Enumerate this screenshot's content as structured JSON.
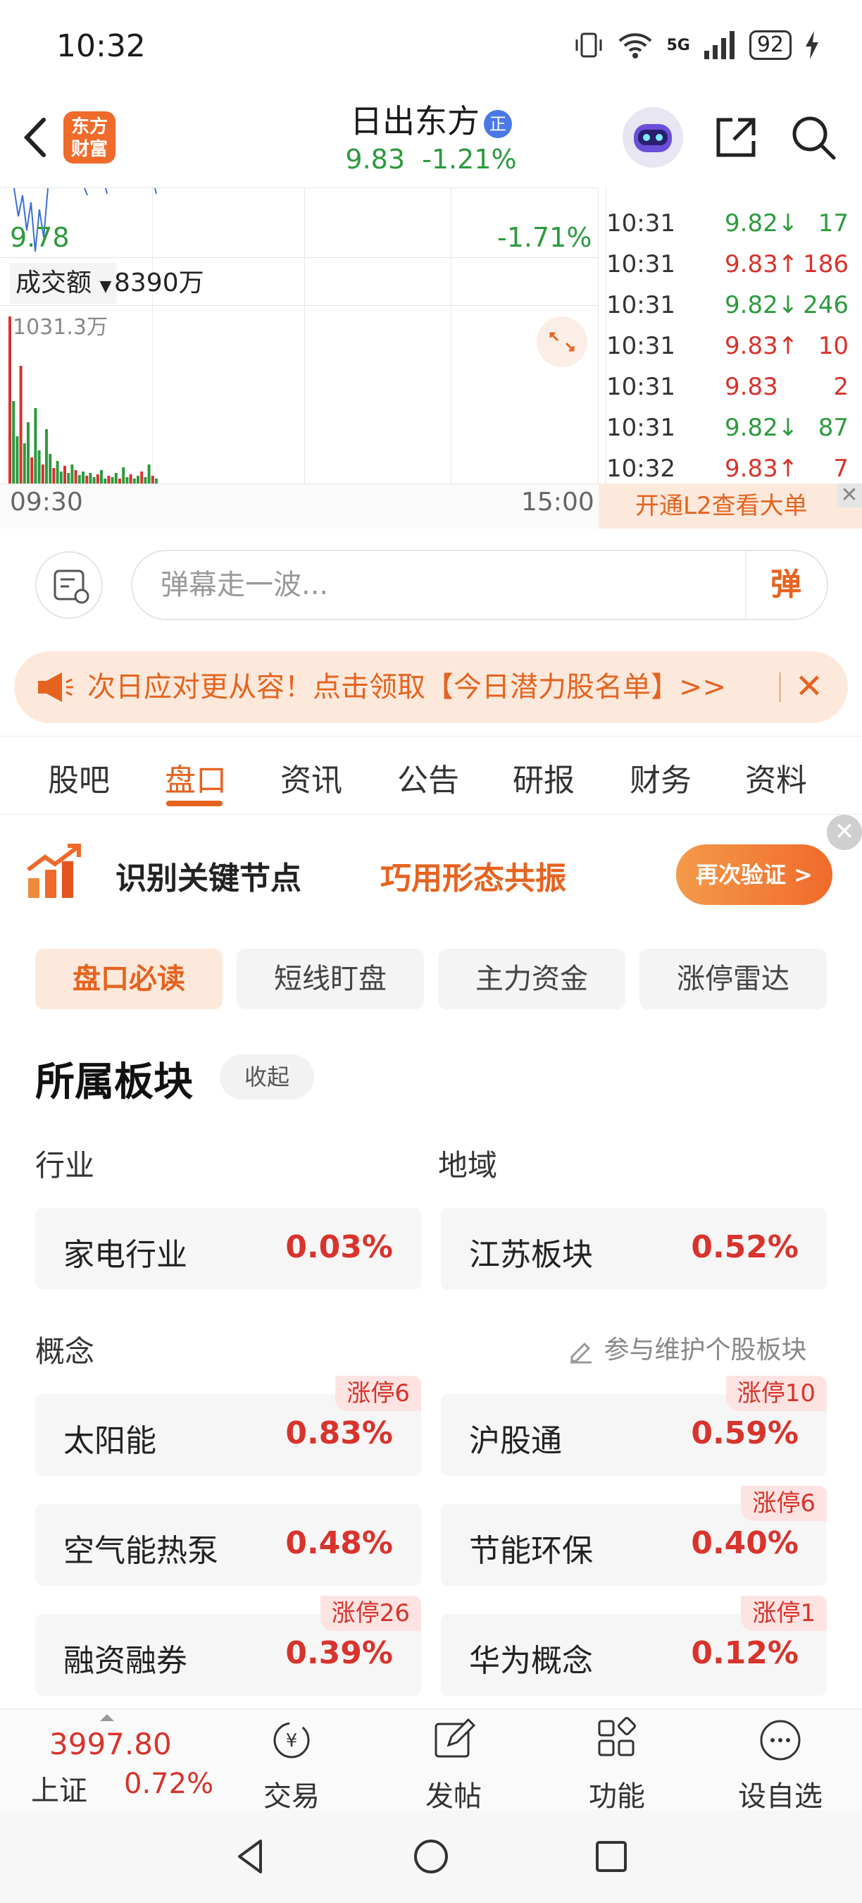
{
  "status_bar": {
    "time": "10:32",
    "network": "5G",
    "battery": "92"
  },
  "header": {
    "logo_text": "东方\n财富",
    "stock_name": "日出东方",
    "stock_tag": "正",
    "price": "9.83",
    "change_pct": "-1.21%"
  },
  "chart": {
    "low_price_label": "9.78",
    "low_pct_label": "-1.71%",
    "volume_selector": "成交额",
    "volume_total": "8390万",
    "volume_max_label": "1031.3万",
    "time_start": "09:30",
    "time_end": "15:00"
  },
  "ticks": [
    {
      "time": "10:31",
      "price": "9.82",
      "dir": "down",
      "vol": "17",
      "color": "#2d9a3e"
    },
    {
      "time": "10:31",
      "price": "9.83",
      "dir": "up",
      "vol": "186",
      "color": "#d8332c"
    },
    {
      "time": "10:31",
      "price": "9.82",
      "dir": "down",
      "vol": "246",
      "color": "#2d9a3e"
    },
    {
      "time": "10:31",
      "price": "9.83",
      "dir": "up",
      "vol": "10",
      "color": "#d8332c"
    },
    {
      "time": "10:31",
      "price": "9.83",
      "dir": "none",
      "vol": "2",
      "color": "#d8332c"
    },
    {
      "time": "10:31",
      "price": "9.82",
      "dir": "down",
      "vol": "87",
      "color": "#2d9a3e"
    },
    {
      "time": "10:32",
      "price": "9.83",
      "dir": "up",
      "vol": "7",
      "color": "#d8332c"
    }
  ],
  "l2_banner": "开通L2查看大单",
  "danmu": {
    "placeholder": "弹幕走一波...",
    "send_label": "弹"
  },
  "promo": {
    "text": "次日应对更从容！点击领取【今日潜力股名单】>>"
  },
  "tabs": [
    "股吧",
    "盘口",
    "资讯",
    "公告",
    "研报",
    "财务",
    "资料"
  ],
  "active_tab": "盘口",
  "ad": {
    "title": "识别关键节点",
    "subtitle": "巧用形态共振",
    "button": "再次验证 >"
  },
  "subtabs": [
    "盘口必读",
    "短线盯盘",
    "主力资金",
    "涨停雷达"
  ],
  "sector": {
    "title": "所属板块",
    "collapse": "收起",
    "industry_label": "行业",
    "region_label": "地域",
    "concept_label": "概念",
    "maintain_link": "参与维护个股板块",
    "industry": {
      "name": "家电行业",
      "pct": "0.03%"
    },
    "region": {
      "name": "江苏板块",
      "pct": "0.52%"
    },
    "concepts": [
      {
        "name": "太阳能",
        "pct": "0.83%",
        "badge": "涨停6"
      },
      {
        "name": "沪股通",
        "pct": "0.59%",
        "badge": "涨停10"
      },
      {
        "name": "空气能热泵",
        "pct": "0.48%",
        "badge": ""
      },
      {
        "name": "节能环保",
        "pct": "0.40%",
        "badge": "涨停6"
      },
      {
        "name": "融资融券",
        "pct": "0.39%",
        "badge": "涨停26"
      },
      {
        "name": "华为概念",
        "pct": "0.12%",
        "badge": "涨停1"
      }
    ]
  },
  "toolbar": {
    "index_value": "3997.80",
    "index_name": "上证",
    "index_pct": "0.72%",
    "items": [
      "交易",
      "发帖",
      "功能",
      "设自选"
    ]
  },
  "colors": {
    "accent": "#e6631f",
    "up": "#d8332c",
    "down": "#2d9a3e"
  }
}
